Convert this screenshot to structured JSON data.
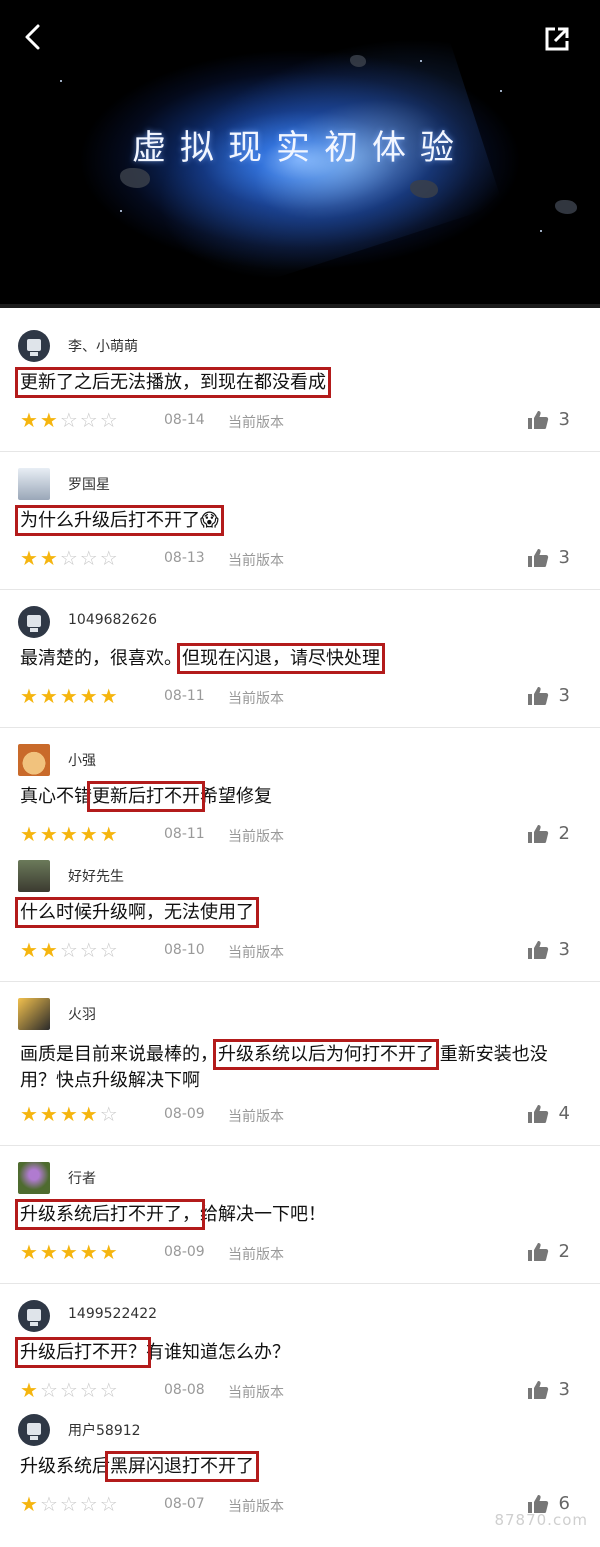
{
  "header": {
    "title": "虚拟现实初体验",
    "back_icon": "chevron-left-icon",
    "share_icon": "share-icon"
  },
  "reviews": [
    {
      "user": "李、小萌萌",
      "content": "更新了之后无法播放，到现在都没看成",
      "highlight": "更新了之后无法播放，到现在都没看成",
      "rating": 2,
      "date": "08-14",
      "version": "当前版本",
      "likes": "3"
    },
    {
      "user": "罗国星",
      "content": "为什么升级后打不开了😱",
      "highlight": "为什么升级后打不开了😱",
      "rating": 2,
      "date": "08-13",
      "version": "当前版本",
      "likes": "3"
    },
    {
      "user": "1049682626",
      "content_pre": "最清楚的，很喜欢。",
      "highlight": "但现在闪退，请尽快处理",
      "content_post": "",
      "rating": 5,
      "date": "08-11",
      "version": "当前版本",
      "likes": "3"
    },
    {
      "user": "小强",
      "content_pre": "真心不错",
      "highlight": "更新后打不开",
      "content_post": "希望修复",
      "rating": 5,
      "date": "08-11",
      "version": "当前版本",
      "likes": "2"
    },
    {
      "user": "好好先生",
      "content": "什么时候升级啊，无法使用了",
      "highlight": "什么时候升级啊，无法使用了",
      "rating": 2,
      "date": "08-10",
      "version": "当前版本",
      "likes": "3"
    },
    {
      "user": "火羽",
      "content_pre": "画质是目前来说最棒的，",
      "highlight": "升级系统以后为何打不开了",
      "content_post": " 重新安装也没用？快点升级解决下啊",
      "rating": 4,
      "date": "08-09",
      "version": "当前版本",
      "likes": "4"
    },
    {
      "user": "行者",
      "content_pre": "",
      "highlight": "升级系统后打不开了，",
      "content_post": "给解决一下吧！",
      "rating": 5,
      "date": "08-09",
      "version": "当前版本",
      "likes": "2"
    },
    {
      "user": "1499522422",
      "content_pre": "",
      "highlight": "升级后打不开？",
      "content_post": "有谁知道怎么办？",
      "rating": 1,
      "date": "08-08",
      "version": "当前版本",
      "likes": "3"
    },
    {
      "user": "用户58912",
      "content_pre": "升级系统后",
      "highlight": "黑屏闪退打不开了",
      "content_post": "",
      "rating": 1,
      "date": "08-07",
      "version": "当前版本",
      "likes": "6"
    }
  ],
  "watermark": "87870.com",
  "colors": {
    "star_on": "#f5b50f",
    "star_off": "#c9c9c9",
    "highlight_box": "#b31b1b"
  }
}
